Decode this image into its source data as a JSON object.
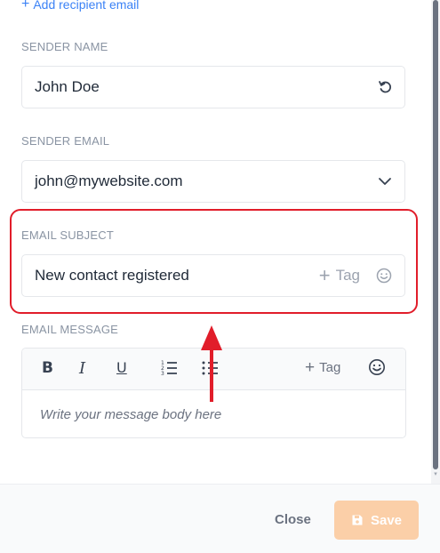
{
  "recipient": {
    "add_label": "Add recipient email"
  },
  "sender_name": {
    "label": "SENDER NAME",
    "value": "John Doe"
  },
  "sender_email": {
    "label": "SENDER EMAIL",
    "value": "john@mywebsite.com"
  },
  "email_subject": {
    "label": "EMAIL SUBJECT",
    "value": "New contact registered",
    "tag_label": "Tag"
  },
  "email_message": {
    "label": "EMAIL MESSAGE",
    "tag_label": "Tag",
    "placeholder": "Write your message body here",
    "toolbar": {
      "bold": "B",
      "italic": "I",
      "underline": "U"
    }
  },
  "footer": {
    "close_label": "Close",
    "save_label": "Save"
  },
  "colors": {
    "accent_link": "#3b82f6",
    "highlight": "#e11d2a",
    "save_button": "#fbcfa8"
  },
  "icons": [
    "plus-icon",
    "reset-icon",
    "chevron-down-icon",
    "smile-icon",
    "ordered-list-icon",
    "unordered-list-icon",
    "save-icon"
  ]
}
